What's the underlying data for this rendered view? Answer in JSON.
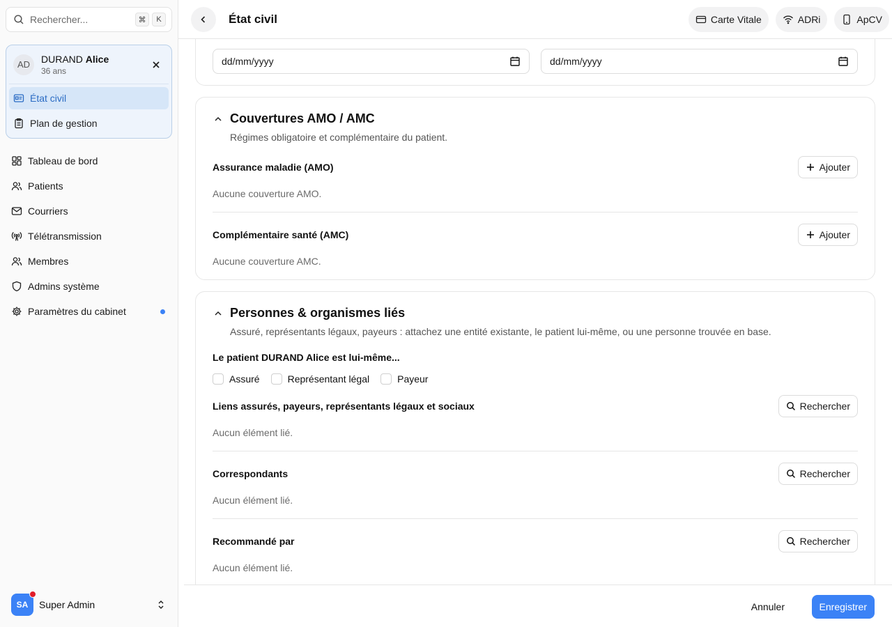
{
  "search": {
    "placeholder": "Rechercher...",
    "kbd1": "⌘",
    "kbd2": "K"
  },
  "patient": {
    "initials": "AD",
    "last_name": "DURAND",
    "first_name": "Alice",
    "age": "36 ans",
    "items": [
      {
        "label": "État civil",
        "icon": "id-card-icon",
        "active": true
      },
      {
        "label": "Plan de gestion",
        "icon": "clipboard-icon",
        "active": false
      }
    ]
  },
  "nav": {
    "items": [
      {
        "label": "Tableau de bord",
        "icon": "dashboard-icon"
      },
      {
        "label": "Patients",
        "icon": "users-icon"
      },
      {
        "label": "Courriers",
        "icon": "mail-icon"
      },
      {
        "label": "Télétransmission",
        "icon": "antenna-icon"
      },
      {
        "label": "Membres",
        "icon": "users-icon"
      },
      {
        "label": "Admins système",
        "icon": "shield-icon"
      },
      {
        "label": "Paramètres du cabinet",
        "icon": "gear-icon",
        "notification_dot": true
      }
    ]
  },
  "user": {
    "initials": "SA",
    "name": "Super Admin"
  },
  "header": {
    "title": "État civil",
    "buttons": [
      {
        "label": "Carte Vitale",
        "icon": "card-icon"
      },
      {
        "label": "ADRi",
        "icon": "wifi-icon"
      },
      {
        "label": "ApCV",
        "icon": "phone-icon"
      }
    ]
  },
  "dates": {
    "placeholder_1": "dd/mm/yyyy",
    "placeholder_2": "dd/mm/yyyy"
  },
  "coverage": {
    "title": "Couvertures AMO / AMC",
    "description": "Régimes obligatoire et complémentaire du patient.",
    "amo_label": "Assurance maladie (AMO)",
    "amo_empty": "Aucune couverture AMO.",
    "amc_label": "Complémentaire santé (AMC)",
    "amc_empty": "Aucune couverture AMC.",
    "add_label": "Ajouter"
  },
  "linked": {
    "title": "Personnes & organismes liés",
    "description": "Assuré, représentants légaux, payeurs : attachez une entité existante, le patient lui-même, ou une personne trouvée en base.",
    "self_label": "Le patient DURAND Alice est lui-même...",
    "checks": [
      "Assuré",
      "Représentant légal",
      "Payeur"
    ],
    "links_label": "Liens assurés, payeurs, représentants légaux et sociaux",
    "correspondants_label": "Correspondants",
    "recommande_label": "Recommandé par",
    "empty": "Aucun élément lié.",
    "search_label": "Rechercher"
  },
  "footer": {
    "cancel": "Annuler",
    "save": "Enregistrer"
  },
  "colors": {
    "accent": "#3b82f6",
    "active_bg": "#d6e6f8",
    "badge": "#e11d2a"
  }
}
